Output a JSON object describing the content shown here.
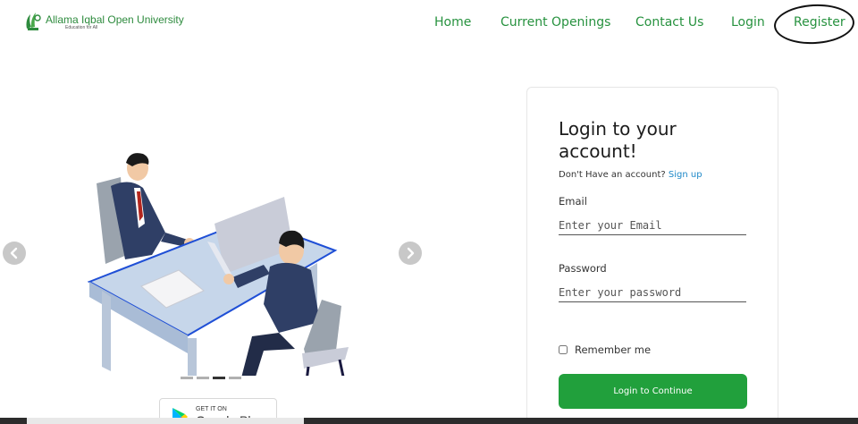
{
  "header": {
    "logo_name": "Allama Iqbal Open University",
    "logo_tagline": "Education for All",
    "nav": {
      "home": "Home",
      "current_openings": "Current Openings",
      "contact_us": "Contact Us",
      "login": "Login",
      "register": "Register"
    }
  },
  "carousel": {
    "slide_count": 4,
    "active_slide": 3,
    "store_badge": {
      "small_text": "GET IT ON",
      "big_text": "Google Pl"
    }
  },
  "login_card": {
    "title": "Login to your account!",
    "signup_prompt": "Don't Have an account?",
    "signup_link": "Sign up",
    "email_label": "Email",
    "email_placeholder": "Enter your Email",
    "password_label": "Password",
    "password_placeholder": "Enter your password",
    "remember_label": "Remember me",
    "submit_label": "Login to Continue"
  },
  "colors": {
    "brand_green": "#27923f",
    "button_green": "#21a03c",
    "link_blue": "#1e88c8"
  }
}
